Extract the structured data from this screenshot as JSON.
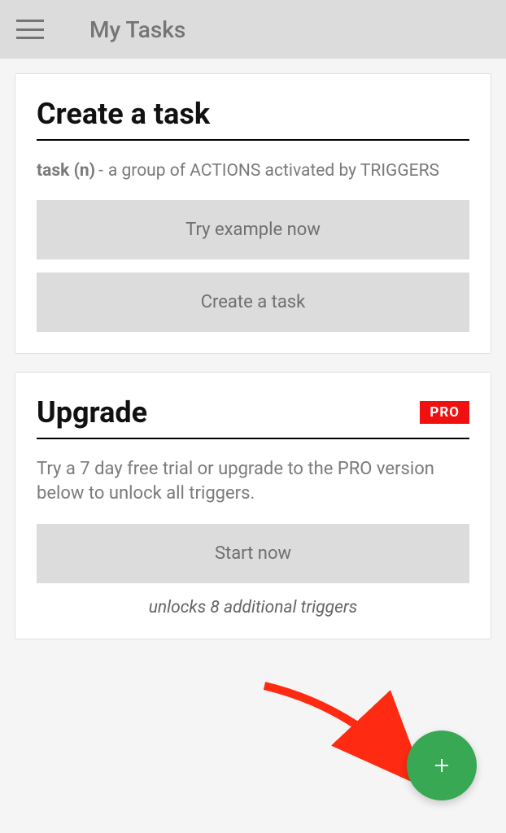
{
  "header": {
    "title": "My Tasks"
  },
  "cards": {
    "create": {
      "title": "Create a task",
      "def_term": "task (n)",
      "def_body": "a group of ACTIONS activated by TRIGGERS",
      "btn_example": "Try example now",
      "btn_create": "Create a task"
    },
    "upgrade": {
      "title": "Upgrade",
      "badge": "PRO",
      "desc": "Try a 7 day free trial or upgrade to the PRO version below to unlock all triggers.",
      "btn_start": "Start now",
      "unlocks": "unlocks 8 additional triggers"
    }
  },
  "colors": {
    "accent_green": "#38a854",
    "pro_red": "#f01010"
  }
}
